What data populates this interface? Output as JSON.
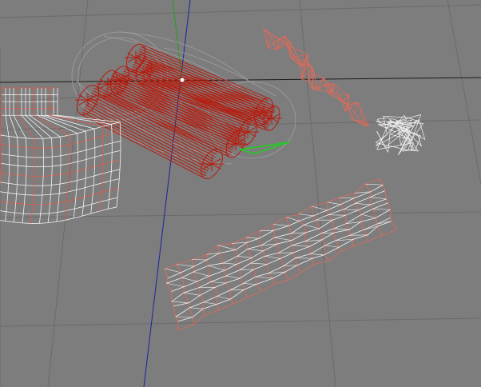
{
  "viewport": {
    "background": "#7d7d7d",
    "grid_color": "#6a6a6a",
    "axis_x_color": "#1a1a1a",
    "axis_y_color": "#1a22a0",
    "axis_z_color": "#1fa01f"
  },
  "objects": [
    {
      "name": "wood-logs",
      "color": "#b81a0c"
    },
    {
      "name": "selection-cage",
      "color": "#9a9a9a"
    },
    {
      "name": "left-fabric",
      "color": "#e25c4a",
      "inner_color": "#f2f2f2"
    },
    {
      "name": "top-right-strip",
      "color": "#e06a5a"
    },
    {
      "name": "small-white-tangle",
      "color": "#f4f4f4"
    },
    {
      "name": "long-mesh",
      "color": "#e06a5a",
      "inner_color": "#f4f4f4"
    },
    {
      "name": "green-gizmo",
      "color": "#22cc22"
    }
  ]
}
